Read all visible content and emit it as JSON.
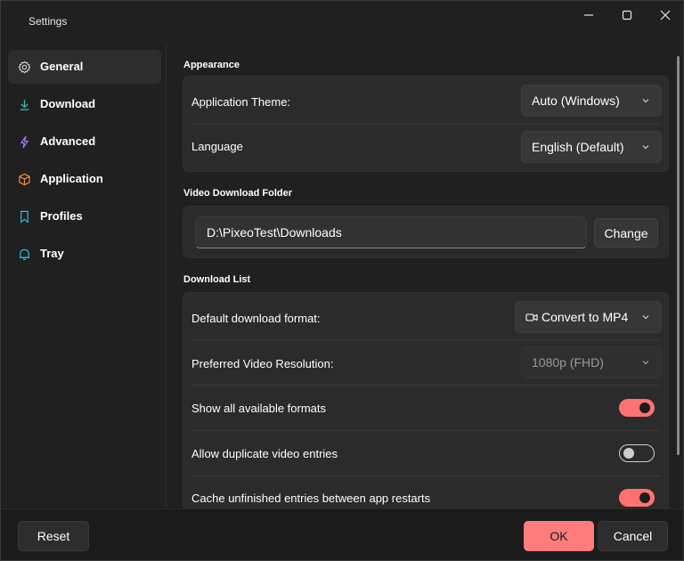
{
  "window": {
    "title": "Settings",
    "accent": "#ff7272"
  },
  "sidebar": {
    "items": [
      {
        "label": "General",
        "icon": "gear-icon",
        "selected": true
      },
      {
        "label": "Download",
        "icon": "download-icon"
      },
      {
        "label": "Advanced",
        "icon": "lightning-icon"
      },
      {
        "label": "Application",
        "icon": "box-icon"
      },
      {
        "label": "Profiles",
        "icon": "bookmark-icon"
      },
      {
        "label": "Tray",
        "icon": "bell-icon"
      }
    ]
  },
  "appearance": {
    "title": "Appearance",
    "theme_label": "Application Theme:",
    "theme_value": "Auto (Windows)",
    "language_label": "Language",
    "language_value": "English (Default)"
  },
  "folder": {
    "title": "Video Download Folder",
    "path": "D:\\PixeoTest\\Downloads",
    "change_label": "Change"
  },
  "download_list": {
    "title": "Download List",
    "format_label": "Default download format:",
    "format_value": "Convert to MP4",
    "resolution_label": "Preferred Video Resolution:",
    "resolution_value": "1080p (FHD)",
    "show_formats_label": "Show all available formats",
    "show_formats_on": true,
    "duplicates_label": "Allow duplicate video entries",
    "duplicates_on": false,
    "cache_label": "Cache unfinished entries between app restarts",
    "cache_on": true
  },
  "footer": {
    "reset_label": "Reset",
    "ok_label": "OK",
    "cancel_label": "Cancel"
  }
}
